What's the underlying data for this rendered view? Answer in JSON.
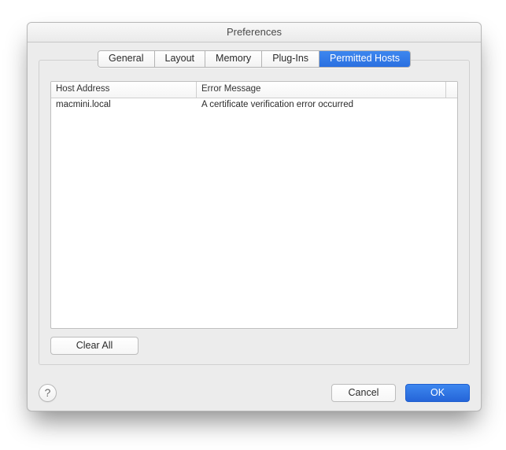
{
  "window": {
    "title": "Preferences"
  },
  "tabs": {
    "items": [
      "General",
      "Layout",
      "Memory",
      "Plug-Ins",
      "Permitted Hosts"
    ],
    "selected_index": 4
  },
  "table": {
    "columns": [
      "Host Address",
      "Error Message"
    ],
    "rows": [
      {
        "host": "macmini.local",
        "message": "A certificate verification error occurred"
      }
    ]
  },
  "buttons": {
    "clear_all": "Clear All",
    "cancel": "Cancel",
    "ok": "OK",
    "help": "?"
  }
}
